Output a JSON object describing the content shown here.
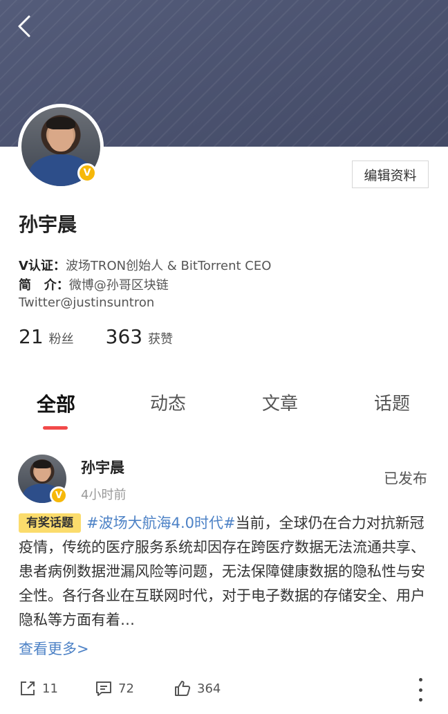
{
  "profile": {
    "name": "孙宇晨",
    "badge": "V",
    "edit_label": "编辑资料",
    "verify_key": "V认证：",
    "verify_value": "波场TRON创始人 & BitTorrent CEO",
    "intro_key": "简   介：",
    "intro_value": "微博@孙哥区块链",
    "intro_line2": "Twitter@justinsuntron"
  },
  "stats": [
    {
      "value": "21",
      "label": "粉丝"
    },
    {
      "value": "363",
      "label": "获赞"
    }
  ],
  "tabs": [
    {
      "label": "全部",
      "active": true
    },
    {
      "label": "动态",
      "active": false
    },
    {
      "label": "文章",
      "active": false
    },
    {
      "label": "话题",
      "active": false
    }
  ],
  "post": {
    "author": "孙宇晨",
    "time": "4小时前",
    "status": "已发布",
    "tag_badge": "有奖话题",
    "hashtag": "#波场大航海4.0时代#",
    "text": "当前，全球仍在合力对抗新冠疫情，传统的医疗服务系统却因存在跨医疗数据无法流通共享、患者病例数据泄漏风险等问题，无法保障健康数据的隐私性与安全性。各行各业在互联网时代，对于电子数据的存储安全、用户隐私等方面有着…",
    "read_more": "查看更多>",
    "shares": "11",
    "comments": "72",
    "likes": "364"
  },
  "colors": {
    "banner": "#4a5270",
    "accent_link": "#4d82c6",
    "tab_indicator": "#f24a4a",
    "badge_yellow": "#fbdc6c",
    "verify_gold": "#f6b80a"
  },
  "icons": [
    "back-icon",
    "verified-v-icon",
    "share-icon",
    "comment-icon",
    "like-icon",
    "more-icon"
  ]
}
